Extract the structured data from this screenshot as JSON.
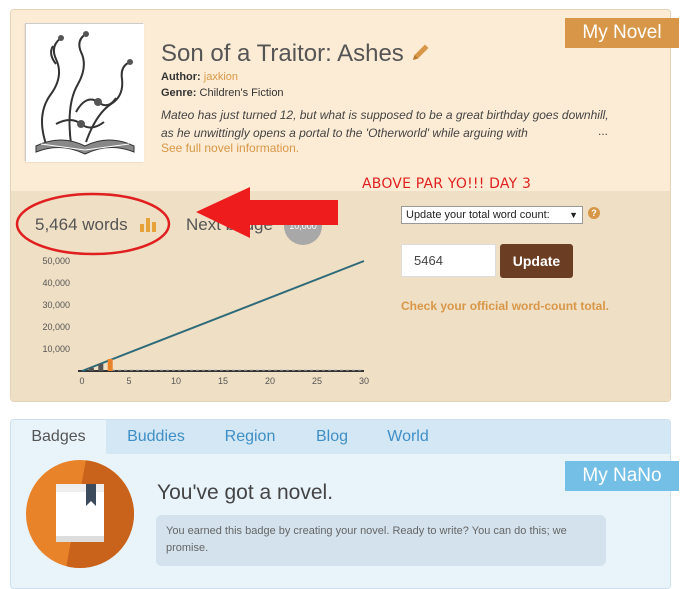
{
  "novel": {
    "ribbon": {
      "my": "My",
      "label": "Novel"
    },
    "title": "Son of a Traitor: Ashes",
    "author_label": "Author:",
    "author": "jaxkion",
    "genre_label": "Genre:",
    "genre": "Children's Fiction",
    "synopsis": "Mateo has just turned 12, but what is supposed to be a great birthday goes downhill, as he unwittingly opens a portal to the 'Otherworld' while arguing with",
    "ellipsis": "...",
    "full_info_link": "See full novel information."
  },
  "annotation": {
    "text": "ABOVE PAR YO!!! DAY 3",
    "color": "#e02020"
  },
  "progress": {
    "word_count": "5,464 words",
    "next_badge_label": "Next badge",
    "next_badge_value": "10,000"
  },
  "update_form": {
    "select_value": "Update your total word count:",
    "input_value": "5464",
    "update_button": "Update",
    "official_link": "Check your official word-count total."
  },
  "chart_data": {
    "type": "line",
    "x_ticks": [
      "0",
      "5",
      "10",
      "15",
      "20",
      "25",
      "30"
    ],
    "y_ticks": [
      "10,000",
      "20,000",
      "30,000",
      "40,000",
      "50,000"
    ],
    "xlim": [
      0,
      30
    ],
    "ylim": [
      0,
      55000
    ],
    "series": [
      {
        "kind": "line",
        "x": [
          0,
          30
        ],
        "y": [
          0,
          50000
        ],
        "color": "#2e6b7a"
      },
      {
        "kind": "bar",
        "x": [
          1,
          2,
          3
        ],
        "y": [
          1500,
          3200,
          5464
        ],
        "colors": [
          "#555555",
          "#555555",
          "#e8832a"
        ]
      }
    ]
  },
  "badges": {
    "tabs": [
      "Badges",
      "Buddies",
      "Region",
      "Blog",
      "World"
    ],
    "active_tab": "Badges",
    "ribbon": {
      "my": "My",
      "label": "NaNo"
    },
    "heading": "You've got a novel.",
    "description": "You earned this badge by creating your novel. Ready to write? You can do this; we promise."
  },
  "colors": {
    "accent_orange": "#d89748",
    "brown_button": "#6b3e24",
    "tab_blue": "#3f8fc6",
    "nano_blue": "#73bfe6"
  }
}
